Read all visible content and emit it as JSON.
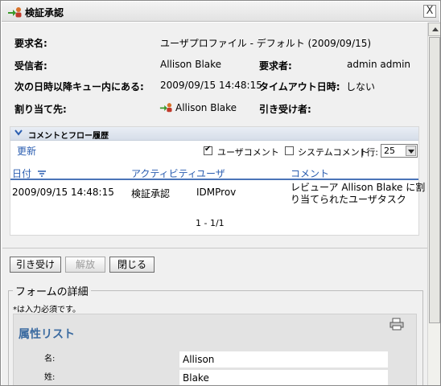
{
  "window": {
    "title": "検証承認",
    "close_glyph": "X"
  },
  "task_info": {
    "request_name_label": "要求名:",
    "request_name_value": "ユーザプロファイル - デフォルト (2009/09/15)",
    "recipient_label": "受信者:",
    "recipient_value": "Allison Blake",
    "requester_label": "要求者:",
    "requester_value": "admin admin",
    "queue_label": "次の日時以降キュー内にある:",
    "queue_value": "2009/09/15 14:48:15",
    "timeout_label": "タイムアウト日時:",
    "timeout_value": "しない",
    "assigned_label": "割り当て先:",
    "assigned_value": "Allison Blake",
    "claimed_label": "引き受け者:",
    "claimed_value": ""
  },
  "comments": {
    "section_title": "コメントとフロー履歴",
    "refresh_label": "更新",
    "user_comments_label": "ユーザコメント",
    "user_comments_checked": true,
    "system_comments_label": "システムコメント",
    "system_comments_checked": false,
    "rows_label": "| 行:",
    "rows_value": "25",
    "columns": {
      "date": "日付",
      "activity": "アクティビティ",
      "user": "ユーザ",
      "comment": "コメント"
    },
    "entries": [
      {
        "date": "2009/09/15 14:48:15",
        "activity": "検証承認",
        "user": "IDMProv",
        "comment_line1": "レビューア Allison Blake に割",
        "comment_line2": "り当てられたユーザタスク"
      }
    ],
    "pager": "1 - 1/1"
  },
  "actions": {
    "claim_label": "引き受け",
    "release_label": "解放",
    "close_label": "閉じる"
  },
  "form": {
    "legend": "フォームの詳細",
    "required_note": "*は入力必須です。",
    "attr_title": "属性リスト",
    "rows": [
      {
        "key": "名:",
        "value": "Allison"
      },
      {
        "key": "姓:",
        "value": "Blake"
      }
    ]
  },
  "colors": {
    "link": "#2a5db0",
    "header_bg": "#d6dee9",
    "attr_title": "#3a6aa0"
  }
}
